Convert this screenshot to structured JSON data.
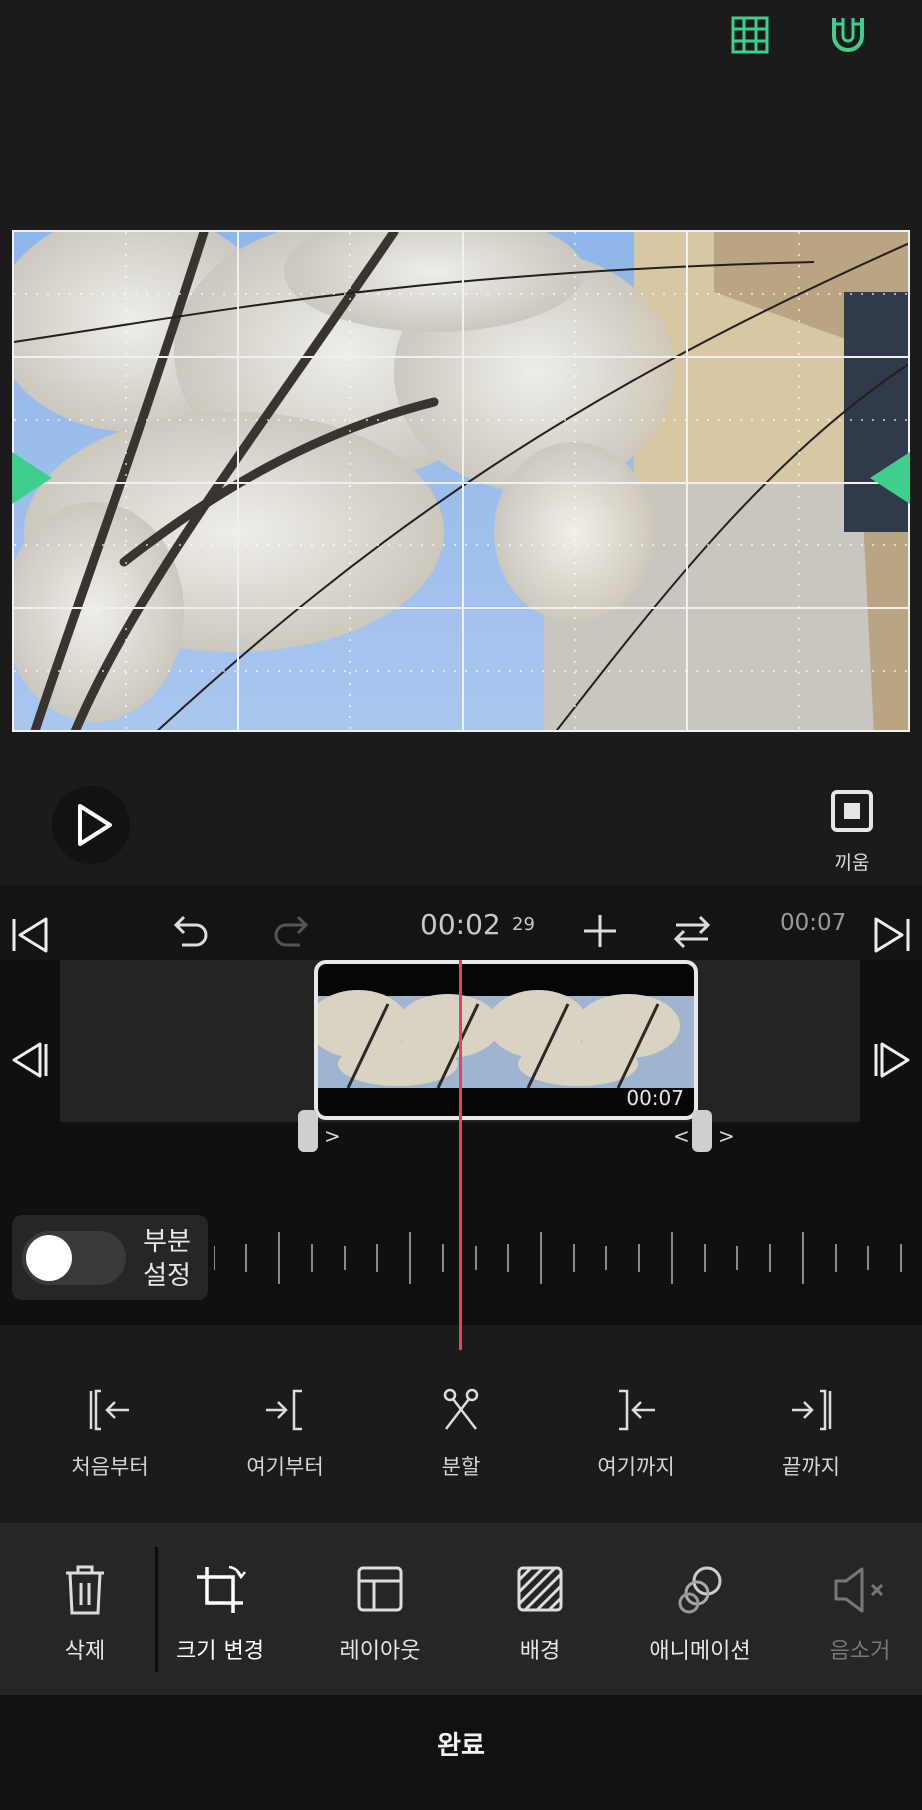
{
  "toolbar_top": {
    "grid_icon": "grid-icon",
    "magnet_icon": "magnet-icon"
  },
  "preview": {
    "fit_label": "끼움"
  },
  "playback": {
    "timecode": "00:02",
    "frame": "29",
    "duration": "00:07"
  },
  "clip": {
    "duration": "00:07"
  },
  "partial": {
    "label_line1": "부분",
    "label_line2": "설정"
  },
  "edit_actions": [
    {
      "label": "처음부터",
      "icon": "trim-start-icon"
    },
    {
      "label": "여기부터",
      "icon": "trim-from-here-icon"
    },
    {
      "label": "분할",
      "icon": "split-scissors-icon"
    },
    {
      "label": "여기까지",
      "icon": "trim-to-here-icon"
    },
    {
      "label": "끝까지",
      "icon": "trim-end-icon"
    }
  ],
  "bottom_menu": [
    {
      "label": "삭제",
      "icon": "trash-icon"
    },
    {
      "label": "크기 변경",
      "icon": "crop-rotate-icon"
    },
    {
      "label": "레이아웃",
      "icon": "layout-icon"
    },
    {
      "label": "배경",
      "icon": "background-pattern-icon"
    },
    {
      "label": "애니메이션",
      "icon": "animation-icon"
    },
    {
      "label": "음소거",
      "icon": "mute-icon"
    }
  ],
  "done_label": "완료",
  "colors": {
    "accent": "#3ecf8e",
    "playhead": "#e0455b"
  }
}
